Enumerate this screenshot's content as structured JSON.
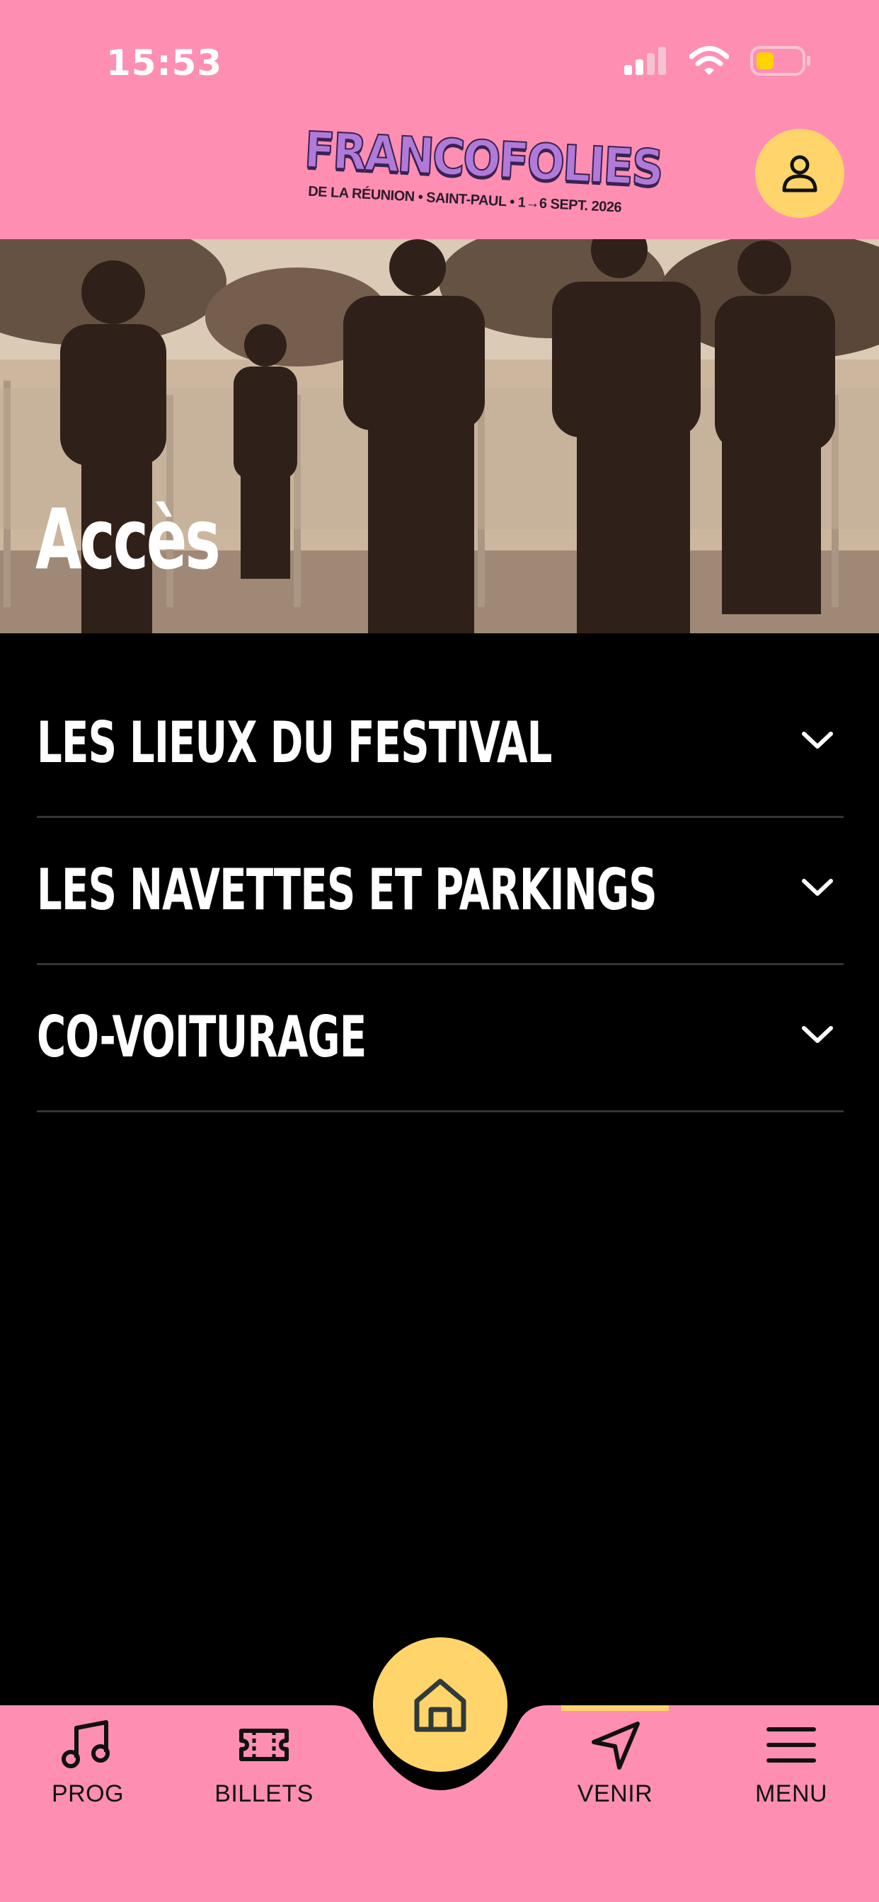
{
  "status_bar": {
    "time": "15:53"
  },
  "header": {
    "logo_title": "FRANCOFOLIES",
    "logo_subtitle": "DE LA RÉUNION • SAINT-PAUL • 1→6 SEPT. 2026",
    "profile_icon": "person-icon"
  },
  "hero": {
    "title": "Accès"
  },
  "accordion": {
    "items": [
      {
        "label": "LES LIEUX DU FESTIVAL",
        "icon": "chevron-down-icon"
      },
      {
        "label": "LES NAVETTES ET PARKINGS",
        "icon": "chevron-down-icon"
      },
      {
        "label": "CO-VOITURAGE",
        "icon": "chevron-down-icon"
      }
    ]
  },
  "tabbar": {
    "items": [
      {
        "label": "PROG",
        "icon": "music-note-icon"
      },
      {
        "label": "BILLETS",
        "icon": "ticket-icon"
      },
      {
        "label": "VENIR",
        "icon": "navigation-arrow-icon",
        "active": true
      },
      {
        "label": "MENU",
        "icon": "hamburger-menu-icon"
      }
    ],
    "home_icon": "home-icon"
  },
  "colors": {
    "header_pink": "#fe8fb2",
    "accent_yellow": "#ffd56b",
    "background": "#000000",
    "text_light": "#ffffff"
  }
}
